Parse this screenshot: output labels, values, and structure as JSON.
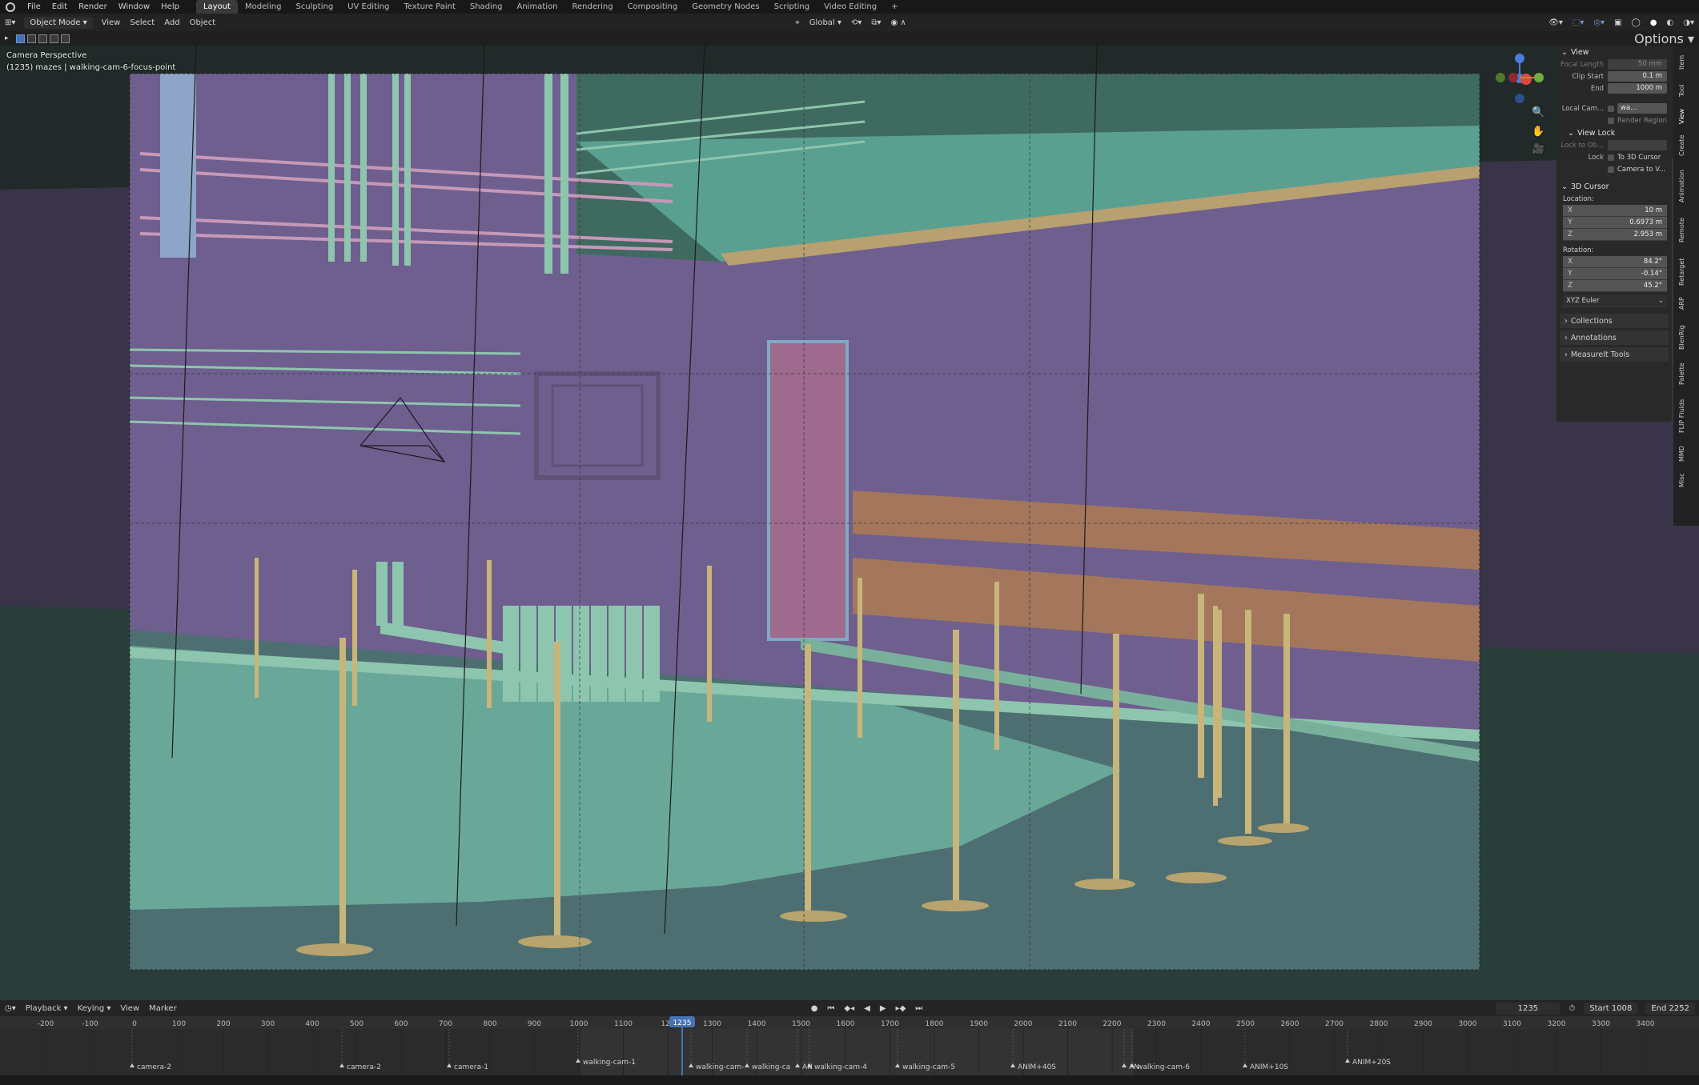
{
  "menubar": {
    "items": [
      "File",
      "Edit",
      "Render",
      "Window",
      "Help"
    ],
    "workspaces": [
      "Layout",
      "Modeling",
      "Sculpting",
      "UV Editing",
      "Texture Paint",
      "Shading",
      "Animation",
      "Rendering",
      "Compositing",
      "Geometry Nodes",
      "Scripting",
      "Video Editing"
    ],
    "active_workspace": "Layout",
    "add_tab": "+"
  },
  "header": {
    "mode": "Object Mode",
    "menus": [
      "View",
      "Select",
      "Add",
      "Object"
    ],
    "orientation": "Global",
    "options": "Options"
  },
  "viewport": {
    "title": "Camera Perspective",
    "subtitle": "(1235) mazes | walking-cam-6-focus-point",
    "colors": {
      "wall": "#6a5a8a",
      "floor": "#4a7a6e",
      "pipe": "#8fc4b0",
      "pole": "#c8b57a",
      "wood": "#a87a5a",
      "door": "#b07a9a",
      "railing": "#c99abb"
    }
  },
  "npanel": {
    "view_header": "View",
    "focal_length_label": "Focal Length",
    "focal_length": "50 mm",
    "clip_start_label": "Clip Start",
    "clip_start": "0.1 m",
    "end_label": "End",
    "end": "1000 m",
    "local_camera_label": "Local Cam...",
    "local_camera_value": "wa...",
    "render_region": "Render Region",
    "view_lock_header": "View Lock",
    "lock_to_object_label": "Lock to Ob...",
    "lock_label": "Lock",
    "to_3d_cursor": "To 3D Cursor",
    "camera_to_view": "Camera to V...",
    "cursor_header": "3D Cursor",
    "location_label": "Location:",
    "loc_x": "10 m",
    "loc_y": "0.6973 m",
    "loc_z": "2.953 m",
    "rotation_label": "Rotation:",
    "rot_x": "84.2°",
    "rot_y": "-0.14°",
    "rot_z": "45.2°",
    "rotation_mode": "XYZ Euler",
    "collections": "Collections",
    "annotations": "Annotations",
    "measureit": "MeasureIt Tools"
  },
  "side_tabs": [
    "Item",
    "Tool",
    "View",
    "Create",
    "Animation",
    "Remote",
    "Retarget",
    "ARP",
    "BlenRig",
    "Palette",
    "FLIP Fluids",
    "MMD",
    "Misc"
  ],
  "timeline": {
    "menus": [
      "Playback",
      "Keying",
      "View",
      "Marker"
    ],
    "current_frame": "1235",
    "start_label": "Start",
    "start": "1008",
    "end_label": "End",
    "end": "2252",
    "ruler_ticks": [
      "-200",
      "-100",
      "0",
      "100",
      "200",
      "300",
      "400",
      "500",
      "600",
      "700",
      "800",
      "900",
      "1000",
      "1100",
      "120",
      "1300",
      "1400",
      "1500",
      "1600",
      "1700",
      "1800",
      "1900",
      "2000",
      "2100",
      "2200",
      "2300",
      "2400",
      "2500",
      "2600",
      "2700",
      "2800",
      "2900",
      "3000",
      "3100",
      "3200",
      "3300",
      "3400"
    ],
    "playhead": "1235",
    "markers": [
      "camera-2",
      "camera-2",
      "camera-1",
      "walking-cam-1",
      "walking-cam-",
      "walking-ca",
      "AN",
      "walking-cam-4",
      "walking-cam-5",
      "ANIM+40S",
      "AN",
      "walking-cam-6",
      "ANIM+10S",
      "ANIM+20S"
    ]
  }
}
